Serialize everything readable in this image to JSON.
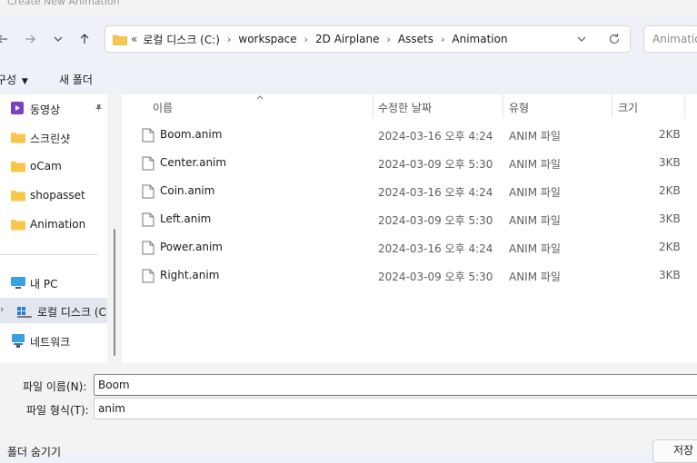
{
  "window": {
    "title": "Create New Animation"
  },
  "address": {
    "overflow": "«",
    "crumbs": [
      "로컬 디스크 (C:)",
      "workspace",
      "2D Airplane",
      "Assets",
      "Animation"
    ],
    "search_placeholder": "Animation"
  },
  "toolbar": {
    "organize": "구성",
    "new_folder": "새 폴더"
  },
  "sidebar": {
    "quick": [
      "동영상",
      "스크린샷",
      "oCam",
      "shopasset",
      "Animation"
    ],
    "pc": "내 PC",
    "local_disk": "로컬 디스크 (C",
    "network": "네트워크"
  },
  "columns": {
    "name": "이름",
    "date": "수정한 날짜",
    "type": "유형",
    "size": "크기"
  },
  "files": [
    {
      "name": "Boom.anim",
      "date": "2024-03-16 오후 4:24",
      "type": "ANIM 파일",
      "size": "2KB"
    },
    {
      "name": "Center.anim",
      "date": "2024-03-09 오후 5:30",
      "type": "ANIM 파일",
      "size": "3KB"
    },
    {
      "name": "Coin.anim",
      "date": "2024-03-16 오후 4:24",
      "type": "ANIM 파일",
      "size": "2KB"
    },
    {
      "name": "Left.anim",
      "date": "2024-03-09 오후 5:30",
      "type": "ANIM 파일",
      "size": "3KB"
    },
    {
      "name": "Power.anim",
      "date": "2024-03-16 오후 4:24",
      "type": "ANIM 파일",
      "size": "2KB"
    },
    {
      "name": "Right.anim",
      "date": "2024-03-09 오후 5:30",
      "type": "ANIM 파일",
      "size": "3KB"
    }
  ],
  "footer": {
    "filename_label": "파일 이름(N):",
    "filename_value": "Boom",
    "filetype_label": "파일 형식(T):",
    "filetype_value": "anim",
    "hide_folders": "폴더 숨기기",
    "save_button": "저장"
  },
  "colors": {
    "accent": "#0067c0",
    "folder": "#f8c74a"
  }
}
